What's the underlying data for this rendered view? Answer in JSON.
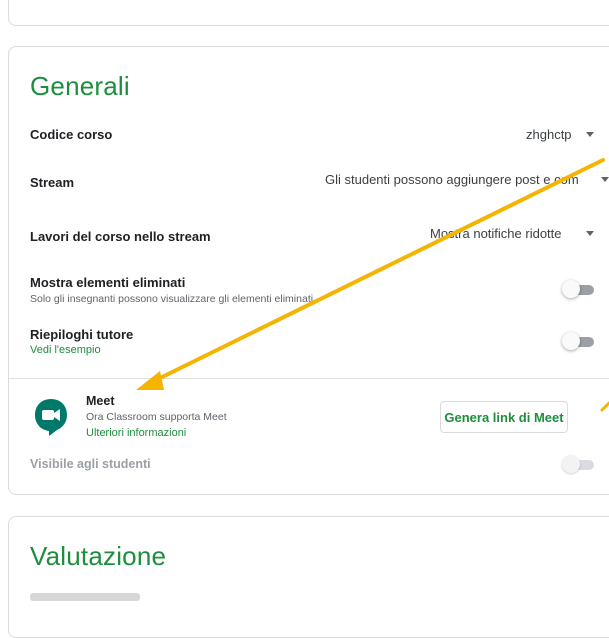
{
  "general": {
    "title": "Generali",
    "class_code": {
      "label": "Codice corso",
      "value": "zhghctp"
    },
    "stream": {
      "label": "Stream",
      "value": "Gli studenti possono aggiungere post e com"
    },
    "classwork": {
      "label": "Lavori del corso nello stream",
      "value": "Mostra notifiche ridotte"
    },
    "deleted_items": {
      "label": "Mostra elementi eliminati",
      "subtitle": "Solo gli insegnanti possono visualizzare gli elementi eliminati",
      "enabled": false
    },
    "guardian": {
      "label": "Riepiloghi tutore",
      "link": "Vedi l'esempio",
      "enabled": false
    },
    "meet": {
      "title": "Meet",
      "subtitle": "Ora Classroom supporta Meet",
      "link": "Ulteriori informazioni",
      "button_label": "Genera link di Meet",
      "visible_label": "Visibile agli studenti",
      "visible_enabled": false
    }
  },
  "grading": {
    "title": "Valutazione"
  },
  "annotation": {
    "arrow_color": "#f4b400"
  },
  "colors": {
    "accent": "#1e8e3e",
    "meet_icon": "#00796b"
  }
}
